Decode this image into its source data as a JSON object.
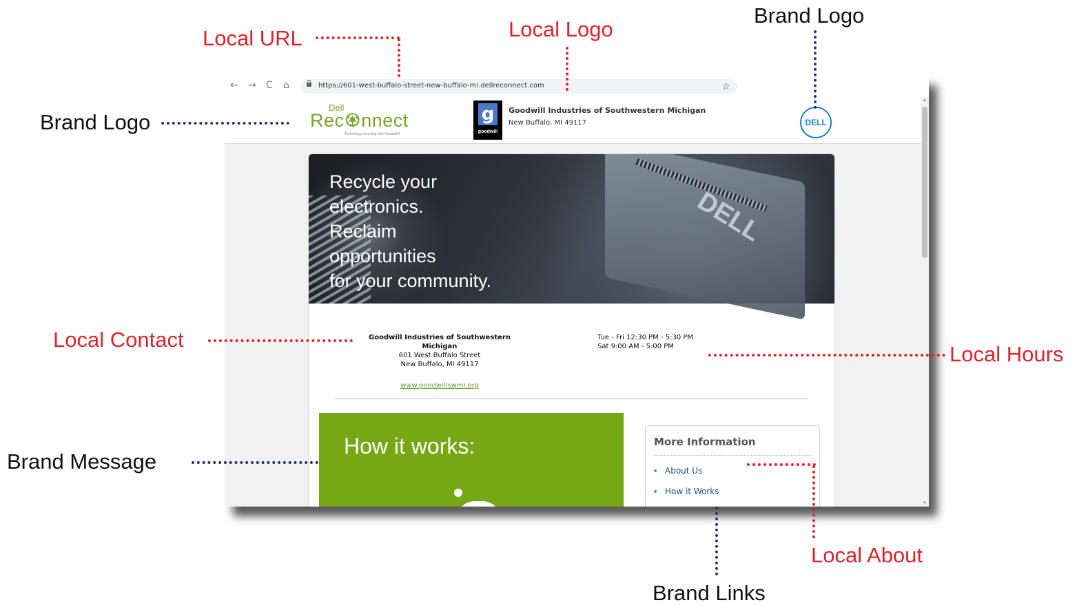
{
  "callouts": {
    "local_url": "Local URL",
    "local_logo": "Local Logo",
    "brand_logo_top": "Brand Logo",
    "brand_logo_left": "Brand Logo",
    "local_contact": "Local Contact",
    "local_hours": "Local Hours",
    "brand_message": "Brand Message",
    "local_about": "Local About",
    "brand_links": "Brand Links"
  },
  "browser": {
    "back_icon": "←",
    "forward_icon": "→",
    "reload_icon": "C",
    "home_icon": "⌂",
    "url": "https://601-west-buffalo-street-new-buffalo-mi.dellreconnect.com",
    "bookmark_icon": "☆"
  },
  "header": {
    "reconnect_dell": "Dell",
    "reconnect_word": "Rec♼nnect",
    "reconnect_tagline": "Technology recycling with Goodwill®",
    "goodwill_mark": "g",
    "goodwill_word": "goodwill",
    "org_name": "Goodwill Industries of Southwestern Michigan",
    "org_city": "New Buffalo, MI 49117",
    "dell_logo_text": "DELL"
  },
  "hero": {
    "lines": [
      "Recycle your",
      "electronics.",
      "Reclaim",
      "opportunities",
      "for your community."
    ],
    "monitor_text": "DELL"
  },
  "contact": {
    "name": "Goodwill Industries of Southwestern Michigan",
    "street": "601 West Buffalo Street",
    "city": "New Buffalo, MI 49117",
    "website": "www.goodwillswmi.org"
  },
  "hours": {
    "line1": "Tue - Fri 12:30 PM - 5:30 PM",
    "line2": "Sat 9:00 AM - 5:00 PM"
  },
  "how_it_works": {
    "title": "How it works:"
  },
  "more_info": {
    "title": "More Information",
    "items": [
      "About Us",
      "How it Works"
    ]
  },
  "scrollbar": {
    "up_icon": "▲",
    "down_icon": "▼"
  },
  "colors": {
    "callout_red": "#e0232a",
    "dot_blue": "#22356f",
    "reconnect_green": "#79a42c",
    "how_box_green": "#76a714",
    "dell_blue": "#1a82c4",
    "link_blue": "#1f4e8c"
  }
}
